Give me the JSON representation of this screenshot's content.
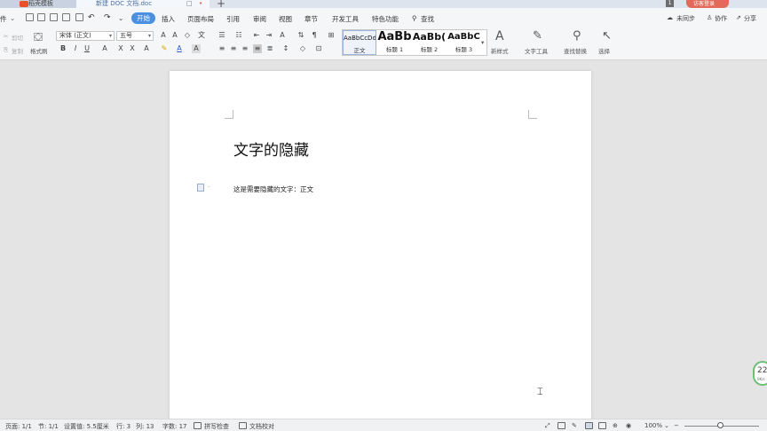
{
  "window": {
    "tabs": [
      {
        "label": "稻壳模板"
      },
      {
        "label": "新建 DOC 文档.doc"
      }
    ],
    "new_tab_symbol": "+",
    "badge": "1",
    "visitor_label": "访客登录"
  },
  "menubar": {
    "file_label": "件",
    "items": [
      "开始",
      "插入",
      "页面布局",
      "引用",
      "审阅",
      "视图",
      "章节",
      "开发工具",
      "特色功能"
    ],
    "search_label": "查找",
    "sync_label": "未同步",
    "collab_label": "协作",
    "share_label": "分享"
  },
  "ribbon": {
    "cut_label": "剪切",
    "copy_label": "复制",
    "format_painter_label": "格式刷",
    "font_name": "宋体 (正文)",
    "font_size": "五号",
    "styles": [
      {
        "sample": "AaBbCcDd",
        "name": "正文"
      },
      {
        "sample": "AaBb",
        "name": "标题 1"
      },
      {
        "sample": "AaBb(",
        "name": "标题 2"
      },
      {
        "sample": "AaBbC",
        "name": "标题 3"
      }
    ],
    "new_style_label": "新样式",
    "text_tools_label": "文字工具",
    "find_replace_label": "查找替换",
    "select_label": "选择"
  },
  "document": {
    "title": "文字的隐藏",
    "body": "这是需要隐藏的文字：正文"
  },
  "speed_widget": {
    "value": "22",
    "unit": "0K/s"
  },
  "statusbar": {
    "page": "页面: 1/1",
    "section": "节: 1/1",
    "position": "设置值: 5.5厘米",
    "row": "行: 3",
    "col": "列: 13",
    "word_count": "字数: 17",
    "spell_check": "拼写检查",
    "doc_proof": "文档校对",
    "zoom": "100%"
  },
  "colors": {
    "accent": "#4a8fe0",
    "visitor": "#e36a5a",
    "speed_ring": "#6dbf76"
  }
}
